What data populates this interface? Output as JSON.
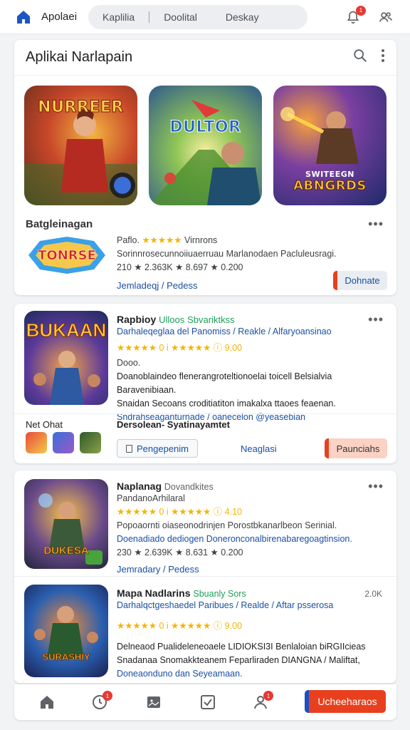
{
  "topbar": {
    "app_name": "Apolaei",
    "tabs": [
      "Kaplilia",
      "Doolital",
      "Deskay"
    ],
    "notification_count": "1",
    "home_icon": "home-icon",
    "bell_icon": "bell-icon",
    "people_icon": "people-icon"
  },
  "featured": {
    "title": "Aplikai Narlapain",
    "thumbs": [
      {
        "title": "NURREER",
        "colors": [
          "#b8401f",
          "#f2b13c"
        ]
      },
      {
        "title": "DULTOR",
        "colors": [
          "#2a6fb0",
          "#f1e088"
        ]
      },
      {
        "title": "ABNGRDS",
        "colors": [
          "#2b3d8a",
          "#f08a2a"
        ],
        "subtitle": "SWITEEGN"
      }
    ],
    "section_label": "Batgleinagan",
    "item": {
      "logo_text": "TONRSE",
      "line1_prefix": "Paflo.",
      "line1_suffix": "Virnrons",
      "line2": "Sorinnrosecunnoiiuaerruau Marlanodaen Pacluleusragi.",
      "line3": "210 ★ 2.363K ★ 8.697 ★ 0.200",
      "link": "Jemladeqj / Pedess",
      "button": "Dohnate"
    }
  },
  "card2": {
    "icon_text": "BUKAAN",
    "title": "Rapbioy",
    "tag": "Ulloos",
    "tag2": "Sbvariktkss",
    "subtitle": "Darhaleqeglaa del Panomiss / Reakle / Alfaryoansinao",
    "rating_line": "★★★★★ 0 i ★★★★★ ⓘ 9.00",
    "label_short": "Dooo.",
    "desc1": "Doanoblaindeo flenerangroteltionoelai toicell Belsialvia Baravenibiaan.",
    "desc2": "Snaidan Secoans croditiatiton imakalxa ttaoes feaenan.",
    "desc3": "Sndrahseaganturnade / oanecelon @yeasebian",
    "footer_left": "Net Ohat",
    "footer_title": "Dersolean- Syatinayamtet",
    "btn_outline": "Pengepenim",
    "btn_link": "Neaglasi",
    "btn_orange": "Paunciahs"
  },
  "card3": {
    "title": "Naplanag",
    "tag": "Dovandkites",
    "subtitle": "PandanoArhilaral",
    "rating_line": "★★★★★ 0 i ★★★★★ ⓘ 4.10",
    "line_a": "Popoaornti oiaseonodrinjen Porostbkanarlbeon Serinial.",
    "line_b": "Doenadiado dediogen Doneronconalbirenabaregoagtinsion.",
    "stats": "230 ★ 2.639K ★ 8.631 ★ 0.200",
    "link": "Jemradary / Pedess",
    "icon_text": "DUKESA"
  },
  "card4": {
    "title": "Mapa Nadlarins",
    "tag": "Sbuanly Sors",
    "count": "2.0K",
    "subtitle": "Darhalqctgeshaedel Paribues / Realde / Aftar psserosa",
    "rating_line": "★★★★★ 0 i ★★★★★ ⓘ 9.00",
    "desc1": "Delneaod Pualideleneoaele LIDIOKSI3I Benlaloian biRGIIcieas",
    "desc2": "Snadanaa Snomakkteanem Feparliraden DIANGNA / Maliftat,",
    "desc3": "Doneaonduno dan Seyeamaan.",
    "icon_text": "SURASHIY"
  },
  "bottom_nav": {
    "items": [
      "home-icon",
      "clock-icon",
      "gallery-icon",
      "check-icon",
      "user-icon"
    ],
    "badge": "1",
    "cta": "Ucheeharaos"
  },
  "colors": {
    "accent_blue": "#1a73e8",
    "orange": "#e8501e",
    "star": "#f4b400"
  }
}
